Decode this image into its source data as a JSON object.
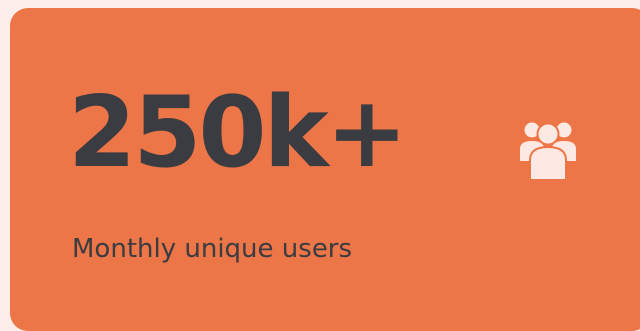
{
  "stat": {
    "value": "250k+",
    "label": "Monthly unique users",
    "icon": "users-group-icon"
  },
  "colors": {
    "page_background": "#fdeee9",
    "card_background": "#ec7647",
    "text": "#3b3b42",
    "icon": "#fde9e4"
  }
}
